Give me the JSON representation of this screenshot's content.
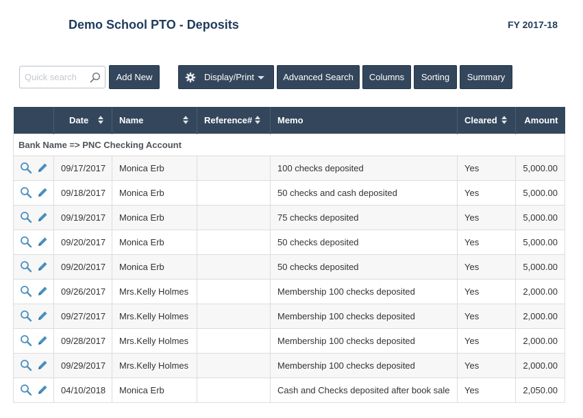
{
  "header": {
    "title": "Demo School PTO - Deposits",
    "fiscal_year": "FY 2017-18"
  },
  "toolbar": {
    "search_placeholder": "Quick search",
    "add_new": "Add New",
    "display_print": "Display/Print",
    "advanced_search": "Advanced Search",
    "columns": "Columns",
    "sorting": "Sorting",
    "summary": "Summary"
  },
  "colors": {
    "header_bg": "#33465c",
    "title": "#1f3b5c",
    "icon": "#4a8fbf"
  },
  "table": {
    "columns": [
      "",
      "Date",
      "Name",
      "Reference#",
      "Memo",
      "Cleared",
      "Amount"
    ],
    "group_label": "Bank Name => PNC Checking Account",
    "rows": [
      {
        "date": "09/17/2017",
        "name": "Monica Erb",
        "reference": "",
        "memo": "100 checks deposited",
        "cleared": "Yes",
        "amount": "5,000.00"
      },
      {
        "date": "09/18/2017",
        "name": "Monica Erb",
        "reference": "",
        "memo": "50 checks and cash deposited",
        "cleared": "Yes",
        "amount": "5,000.00"
      },
      {
        "date": "09/19/2017",
        "name": "Monica Erb",
        "reference": "",
        "memo": "75 checks deposited",
        "cleared": "Yes",
        "amount": "5,000.00"
      },
      {
        "date": "09/20/2017",
        "name": "Monica Erb",
        "reference": "",
        "memo": "50 checks deposited",
        "cleared": "Yes",
        "amount": "5,000.00"
      },
      {
        "date": "09/20/2017",
        "name": "Monica Erb",
        "reference": "",
        "memo": "50 checks deposited",
        "cleared": "Yes",
        "amount": "5,000.00"
      },
      {
        "date": "09/26/2017",
        "name": "Mrs.Kelly Holmes",
        "reference": "",
        "memo": "Membership 100 checks deposited",
        "cleared": "Yes",
        "amount": "2,000.00"
      },
      {
        "date": "09/27/2017",
        "name": "Mrs.Kelly Holmes",
        "reference": "",
        "memo": "Membership 100 checks deposited",
        "cleared": "Yes",
        "amount": "2,000.00"
      },
      {
        "date": "09/28/2017",
        "name": "Mrs.Kelly Holmes",
        "reference": "",
        "memo": "Membership 100 checks deposited",
        "cleared": "Yes",
        "amount": "2,000.00"
      },
      {
        "date": "09/29/2017",
        "name": "Mrs.Kelly Holmes",
        "reference": "",
        "memo": "Membership 100 checks deposited",
        "cleared": "Yes",
        "amount": "2,000.00"
      },
      {
        "date": "04/10/2018",
        "name": "Monica Erb",
        "reference": "",
        "memo": "Cash and Checks deposited after book sale",
        "cleared": "Yes",
        "amount": "2,050.00"
      }
    ]
  }
}
